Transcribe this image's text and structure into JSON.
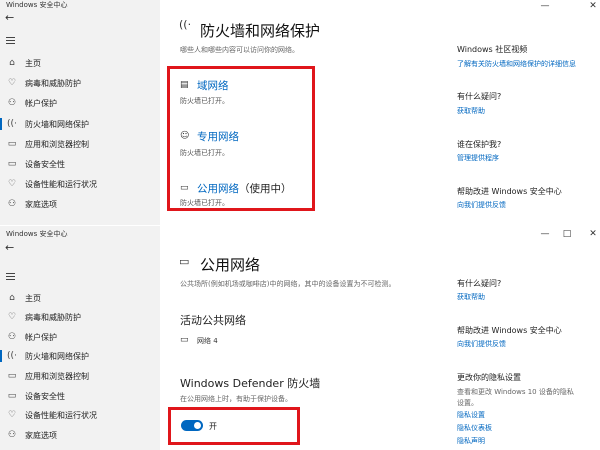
{
  "window1": {
    "title": "Windows 安全中心",
    "controls": {
      "minimize": "—",
      "restore": "□",
      "close": "✕"
    },
    "back": "←",
    "nav": [
      {
        "label": "主页",
        "icon": "home-icon"
      },
      {
        "label": "病毒和威胁防护",
        "icon": "shield-icon"
      },
      {
        "label": "帐户保护",
        "icon": "person-icon"
      },
      {
        "label": "防火墙和网络保护",
        "icon": "wifi-icon"
      },
      {
        "label": "应用和浏览器控制",
        "icon": "app-window-icon"
      },
      {
        "label": "设备安全性",
        "icon": "laptop-icon"
      },
      {
        "label": "设备性能和运行状况",
        "icon": "heart-icon"
      },
      {
        "label": "家庭选项",
        "icon": "family-icon"
      }
    ],
    "page_title": "防火墙和网络保护",
    "page_desc": "哪些人和哪些内容可以访问你的网络。",
    "networks": [
      {
        "name": "域网络",
        "suffix": "",
        "status": "防火墙已打开。",
        "icon": "domain-network-icon"
      },
      {
        "name": "专用网络",
        "suffix": "",
        "status": "防火墙已打开。",
        "icon": "private-network-icon"
      },
      {
        "name": "公用网络",
        "suffix": "（使用中）",
        "status": "防火墙已打开。",
        "icon": "public-network-icon"
      }
    ],
    "side": {
      "community_title": "Windows 社区视频",
      "community_link": "了解有关防火墙和网络保护的详细信息",
      "question_title": "有什么疑问?",
      "help_link": "获取帮助",
      "who_title": "谁在保护我?",
      "providers_link": "管理提供程序",
      "improve_title": "帮助改进 Windows 安全中心",
      "feedback_link": "向我们提供反馈"
    }
  },
  "window2": {
    "title": "Windows 安全中心",
    "controls": {
      "minimize": "—",
      "restore": "□",
      "close": "✕"
    },
    "back": "←",
    "nav": [
      {
        "label": "主页",
        "icon": "home-icon"
      },
      {
        "label": "病毒和威胁防护",
        "icon": "shield-icon"
      },
      {
        "label": "帐户保护",
        "icon": "person-icon"
      },
      {
        "label": "防火墙和网络保护",
        "icon": "wifi-icon"
      },
      {
        "label": "应用和浏览器控制",
        "icon": "app-window-icon"
      },
      {
        "label": "设备安全性",
        "icon": "laptop-icon"
      },
      {
        "label": "设备性能和运行状况",
        "icon": "heart-icon"
      },
      {
        "label": "家庭选项",
        "icon": "family-icon"
      }
    ],
    "page_title": "公用网络",
    "page_desc": "公共场所(例如机场或咖啡店)中的网络，其中的设备设置为不可检测。",
    "active_title": "活动公共网络",
    "active_network": "网络 4",
    "defender_title": "Windows Defender 防火墙",
    "defender_desc": "在公用网络上时，有助于保护设备。",
    "toggle_label": "开",
    "toggle_on": true,
    "side": {
      "question_title": "有什么疑问?",
      "help_link": "获取帮助",
      "improve_title": "帮助改进 Windows 安全中心",
      "feedback_link": "向我们提供反馈",
      "privacy_title": "更改你的隐私设置",
      "privacy_desc_1": "查看和更改 Windows 10 设备的隐私",
      "privacy_desc_2": "设置。",
      "privacy_link1": "隐私设置",
      "privacy_link2": "隐私仪表板",
      "privacy_link3": "隐私声明"
    }
  },
  "colors": {
    "accent": "#0067c0",
    "highlight_box": "#e0161b",
    "sidebar_bg": "#f2f2f2"
  }
}
